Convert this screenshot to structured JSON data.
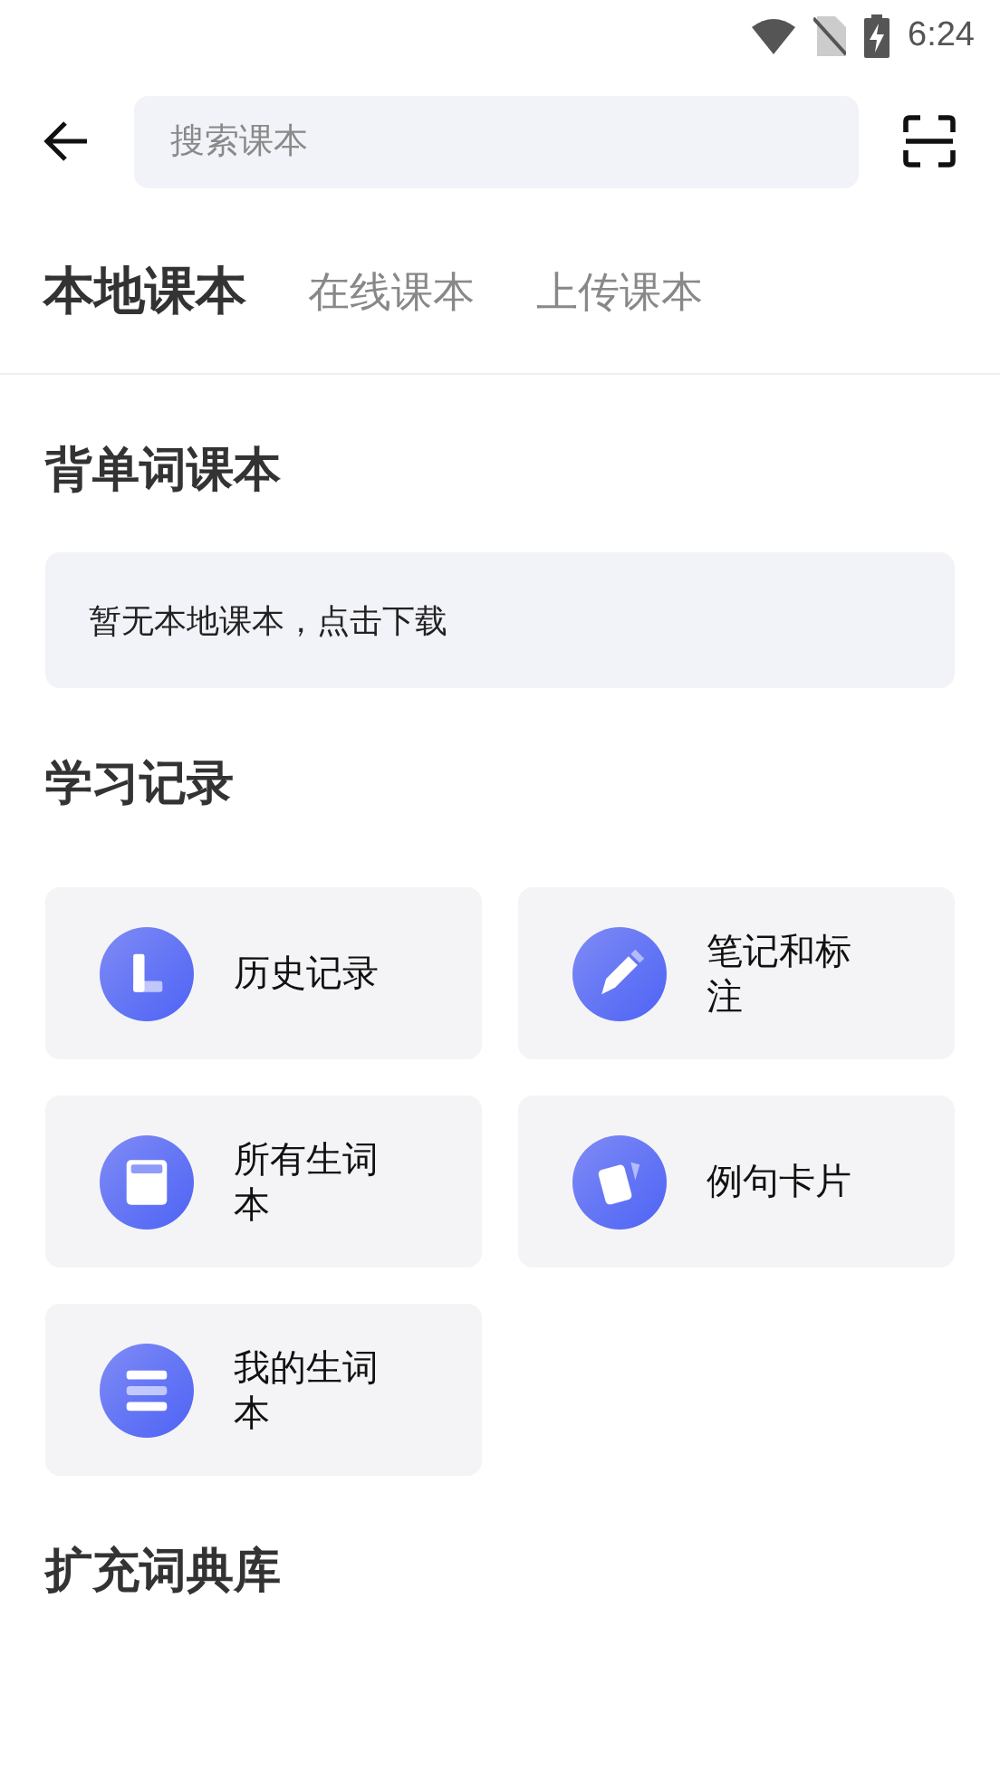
{
  "status_bar": {
    "time": "6:24"
  },
  "search": {
    "placeholder": "搜索课本"
  },
  "tabs": [
    {
      "label": "本地课本",
      "selected": true
    },
    {
      "label": "在线课本",
      "selected": false
    },
    {
      "label": "上传课本",
      "selected": false
    }
  ],
  "sections": [
    {
      "title": "背单词课本",
      "empty_message": "暂无本地课本，点击下载"
    },
    {
      "title": "学习记录",
      "items": [
        {
          "label": "历史记录",
          "kind": "clock"
        },
        {
          "label": "笔记和标注",
          "kind": "pencil"
        },
        {
          "label": "所有生词本",
          "kind": "notebook"
        },
        {
          "label": "例句卡片",
          "kind": "cards"
        },
        {
          "label": "我的生词本",
          "kind": "list"
        }
      ]
    },
    {
      "title": "扩充词典库"
    }
  ]
}
